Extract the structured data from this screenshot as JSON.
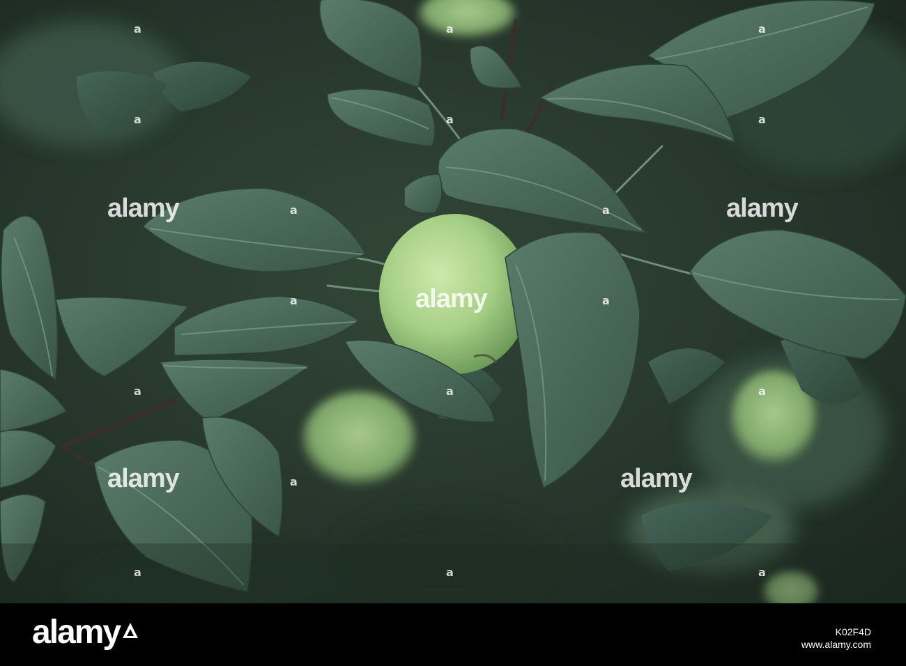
{
  "watermark": {
    "text": "alamy"
  },
  "footer": {
    "brand": "alamy",
    "image_id": "K02F4D",
    "url": "www.alamy.com"
  },
  "colors": {
    "background_foliage": "#27372d",
    "leaf_dark": "#3c5a48",
    "leaf_mid": "#56786a",
    "apple": "#a9d18a",
    "footer": "#000000"
  }
}
